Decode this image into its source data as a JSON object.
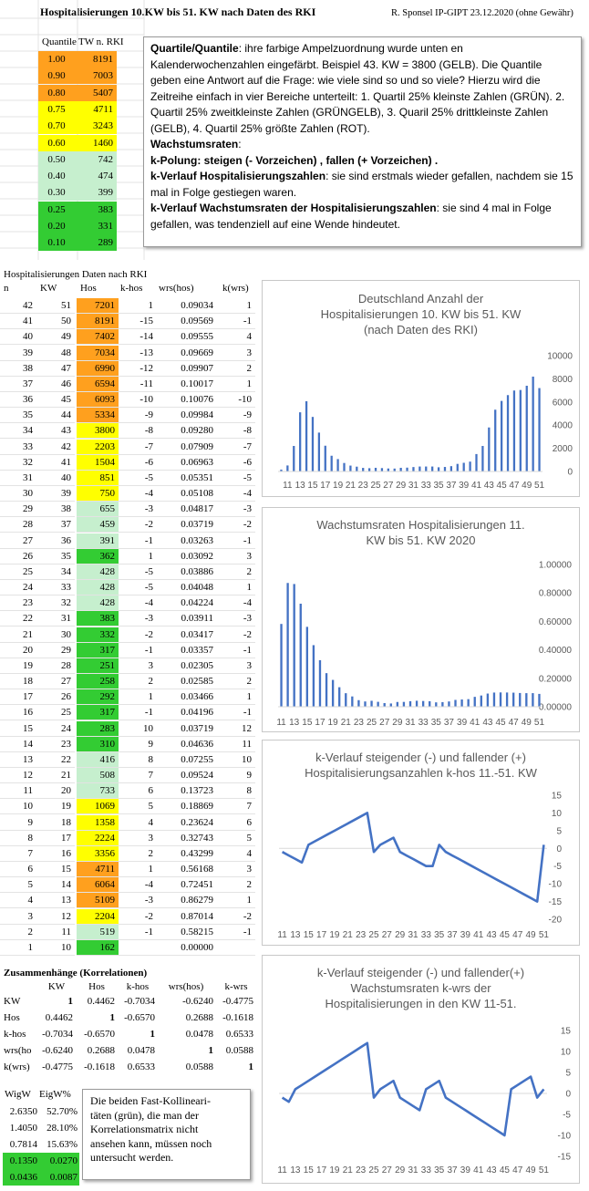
{
  "header": {
    "title": "Hospitalisierungen 10.KW bis 51. KW nach Daten des RKI",
    "right": "R. Sponsel IP-GIPT 23.12.2020 (ohne Gewähr)"
  },
  "colors": {
    "orange": "#ffa01e",
    "yellow": "#ffff00",
    "light_green": "#c6efce",
    "green": "#33cc33",
    "series": "#4472c4"
  },
  "quantile_table": {
    "headers": [
      "Quantile",
      "TW n. RKI"
    ],
    "rows": [
      {
        "q": "1.00",
        "tw": "8191",
        "color": "orange"
      },
      {
        "q": "0.90",
        "tw": "7003",
        "color": "orange"
      },
      {
        "q": "0.80",
        "tw": "5407",
        "color": "orange"
      },
      {
        "q": "0.75",
        "tw": "4711",
        "color": "yellow"
      },
      {
        "q": "0.70",
        "tw": "3243",
        "color": "yellow"
      },
      {
        "q": "0.60",
        "tw": "1460",
        "color": "yellow"
      },
      {
        "q": "0.50",
        "tw": "742",
        "color": "light_green"
      },
      {
        "q": "0.40",
        "tw": "474",
        "color": "light_green"
      },
      {
        "q": "0.30",
        "tw": "399",
        "color": "light_green"
      },
      {
        "q": "0.25",
        "tw": "383",
        "color": "green"
      },
      {
        "q": "0.20",
        "tw": "331",
        "color": "green"
      },
      {
        "q": "0.10",
        "tw": "289",
        "color": "green"
      }
    ]
  },
  "explanation": {
    "p1_bold": "Quartile/Quantile",
    "p1": ": ihre farbige Ampelzuordnung wurde unten en Kalenderwochenzahlen eingefärbt. Beispiel 43. KW = 3800 (GELB). Die Quantile geben eine Antwort auf die Frage: wie viele sind so und so viele? Hierzu wird die Zeitreihe einfach in vier Bereiche unterteilt: 1. Quartil 25% kleinste Zahlen (GRÜN). 2. Quartil 25% zweitkleinste Zahlen (GRÜNGELB), 3. Quaril 25% drittkleinste Zahlen (GELB), 4. Quartil 25% größte Zahlen (ROT).",
    "p2_bold": "Wachstumsraten",
    "p2": ":",
    "p3_bold": "k-Polung: steigen (- Vorzeichen) , fallen (+ Vorzeichen) .",
    "p4_bold": "k-Verlauf Hospitalisierungszahlen",
    "p4": ": sie sind erstmals wieder gefallen, nachdem sie 15 mal in Folge gestiegen waren.",
    "p5_bold": "k-Verlauf Wachstumsraten der Hospitalisierungszahlen",
    "p5": ": sie sind 4 mal in Folge gefallen, was tendenziell auf eine Wende hindeutet."
  },
  "data_table": {
    "title": "Hospitalisierungen Daten nach RKI",
    "headers": [
      "n",
      "KW",
      "Hos",
      "k-hos",
      "wrs(hos)",
      "k(wrs)"
    ],
    "rows": [
      {
        "n": "42",
        "kw": "51",
        "hos": "7201",
        "khos": "1",
        "wrs": "0.09034",
        "kwrs": "1",
        "color": "orange"
      },
      {
        "n": "41",
        "kw": "50",
        "hos": "8191",
        "khos": "-15",
        "wrs": "0.09569",
        "kwrs": "-1",
        "color": "orange"
      },
      {
        "n": "40",
        "kw": "49",
        "hos": "7402",
        "khos": "-14",
        "wrs": "0.09555",
        "kwrs": "4",
        "color": "orange"
      },
      {
        "n": "39",
        "kw": "48",
        "hos": "7034",
        "khos": "-13",
        "wrs": "0.09669",
        "kwrs": "3",
        "color": "orange"
      },
      {
        "n": "38",
        "kw": "47",
        "hos": "6990",
        "khos": "-12",
        "wrs": "0.09907",
        "kwrs": "2",
        "color": "orange"
      },
      {
        "n": "37",
        "kw": "46",
        "hos": "6594",
        "khos": "-11",
        "wrs": "0.10017",
        "kwrs": "1",
        "color": "orange"
      },
      {
        "n": "36",
        "kw": "45",
        "hos": "6093",
        "khos": "-10",
        "wrs": "0.10076",
        "kwrs": "-10",
        "color": "orange"
      },
      {
        "n": "35",
        "kw": "44",
        "hos": "5334",
        "khos": "-9",
        "wrs": "0.09984",
        "kwrs": "-9",
        "color": "orange"
      },
      {
        "n": "34",
        "kw": "43",
        "hos": "3800",
        "khos": "-8",
        "wrs": "0.09280",
        "kwrs": "-8",
        "color": "yellow"
      },
      {
        "n": "33",
        "kw": "42",
        "hos": "2203",
        "khos": "-7",
        "wrs": "0.07909",
        "kwrs": "-7",
        "color": "yellow"
      },
      {
        "n": "32",
        "kw": "41",
        "hos": "1504",
        "khos": "-6",
        "wrs": "0.06963",
        "kwrs": "-6",
        "color": "yellow"
      },
      {
        "n": "31",
        "kw": "40",
        "hos": "851",
        "khos": "-5",
        "wrs": "0.05351",
        "kwrs": "-5",
        "color": "yellow"
      },
      {
        "n": "30",
        "kw": "39",
        "hos": "750",
        "khos": "-4",
        "wrs": "0.05108",
        "kwrs": "-4",
        "color": "yellow"
      },
      {
        "n": "29",
        "kw": "38",
        "hos": "655",
        "khos": "-3",
        "wrs": "0.04817",
        "kwrs": "-3",
        "color": "light_green"
      },
      {
        "n": "28",
        "kw": "37",
        "hos": "459",
        "khos": "-2",
        "wrs": "0.03719",
        "kwrs": "-2",
        "color": "light_green"
      },
      {
        "n": "27",
        "kw": "36",
        "hos": "391",
        "khos": "-1",
        "wrs": "0.03263",
        "kwrs": "-1",
        "color": "light_green"
      },
      {
        "n": "26",
        "kw": "35",
        "hos": "362",
        "khos": "1",
        "wrs": "0.03092",
        "kwrs": "3",
        "color": "green"
      },
      {
        "n": "25",
        "kw": "34",
        "hos": "428",
        "khos": "-5",
        "wrs": "0.03886",
        "kwrs": "2",
        "color": "light_green"
      },
      {
        "n": "24",
        "kw": "33",
        "hos": "428",
        "khos": "-5",
        "wrs": "0.04048",
        "kwrs": "1",
        "color": "light_green"
      },
      {
        "n": "23",
        "kw": "32",
        "hos": "428",
        "khos": "-4",
        "wrs": "0.04224",
        "kwrs": "-4",
        "color": "light_green"
      },
      {
        "n": "22",
        "kw": "31",
        "hos": "383",
        "khos": "-3",
        "wrs": "0.03911",
        "kwrs": "-3",
        "color": "green"
      },
      {
        "n": "21",
        "kw": "30",
        "hos": "332",
        "khos": "-2",
        "wrs": "0.03417",
        "kwrs": "-2",
        "color": "green"
      },
      {
        "n": "20",
        "kw": "29",
        "hos": "317",
        "khos": "-1",
        "wrs": "0.03357",
        "kwrs": "-1",
        "color": "green"
      },
      {
        "n": "19",
        "kw": "28",
        "hos": "251",
        "khos": "3",
        "wrs": "0.02305",
        "kwrs": "3",
        "color": "green"
      },
      {
        "n": "18",
        "kw": "27",
        "hos": "258",
        "khos": "2",
        "wrs": "0.02585",
        "kwrs": "2",
        "color": "green"
      },
      {
        "n": "17",
        "kw": "26",
        "hos": "292",
        "khos": "1",
        "wrs": "0.03466",
        "kwrs": "1",
        "color": "green"
      },
      {
        "n": "16",
        "kw": "25",
        "hos": "317",
        "khos": "-1",
        "wrs": "0.04196",
        "kwrs": "-1",
        "color": "green"
      },
      {
        "n": "15",
        "kw": "24",
        "hos": "283",
        "khos": "10",
        "wrs": "0.03719",
        "kwrs": "12",
        "color": "green"
      },
      {
        "n": "14",
        "kw": "23",
        "hos": "310",
        "khos": "9",
        "wrs": "0.04636",
        "kwrs": "11",
        "color": "green"
      },
      {
        "n": "13",
        "kw": "22",
        "hos": "416",
        "khos": "8",
        "wrs": "0.07255",
        "kwrs": "10",
        "color": "light_green"
      },
      {
        "n": "12",
        "kw": "21",
        "hos": "508",
        "khos": "7",
        "wrs": "0.09524",
        "kwrs": "9",
        "color": "light_green"
      },
      {
        "n": "11",
        "kw": "20",
        "hos": "733",
        "khos": "6",
        "wrs": "0.13723",
        "kwrs": "8",
        "color": "light_green"
      },
      {
        "n": "10",
        "kw": "19",
        "hos": "1069",
        "khos": "5",
        "wrs": "0.18869",
        "kwrs": "7",
        "color": "yellow"
      },
      {
        "n": "9",
        "kw": "18",
        "hos": "1358",
        "khos": "4",
        "wrs": "0.23624",
        "kwrs": "6",
        "color": "yellow"
      },
      {
        "n": "8",
        "kw": "17",
        "hos": "2224",
        "khos": "3",
        "wrs": "0.32743",
        "kwrs": "5",
        "color": "yellow"
      },
      {
        "n": "7",
        "kw": "16",
        "hos": "3356",
        "khos": "2",
        "wrs": "0.43299",
        "kwrs": "4",
        "color": "yellow"
      },
      {
        "n": "6",
        "kw": "15",
        "hos": "4711",
        "khos": "1",
        "wrs": "0.56168",
        "kwrs": "3",
        "color": "orange"
      },
      {
        "n": "5",
        "kw": "14",
        "hos": "6064",
        "khos": "-4",
        "wrs": "0.72451",
        "kwrs": "2",
        "color": "orange"
      },
      {
        "n": "4",
        "kw": "13",
        "hos": "5109",
        "khos": "-3",
        "wrs": "0.86279",
        "kwrs": "1",
        "color": "orange"
      },
      {
        "n": "3",
        "kw": "12",
        "hos": "2204",
        "khos": "-2",
        "wrs": "0.87014",
        "kwrs": "-2",
        "color": "yellow"
      },
      {
        "n": "2",
        "kw": "11",
        "hos": "519",
        "khos": "-1",
        "wrs": "0.58215",
        "kwrs": "-1",
        "color": "light_green"
      },
      {
        "n": "1",
        "kw": "10",
        "hos": "162",
        "khos": "",
        "wrs": "0.00000",
        "kwrs": "",
        "color": "green"
      }
    ]
  },
  "correlations": {
    "title": "Zusammenhänge (Korrelationen)",
    "headers": [
      "KW",
      "Hos",
      "k-hos",
      "wrs(hos)",
      "k-wrs"
    ],
    "rows": [
      {
        "label": "KW",
        "vals": [
          "1",
          "0.4462",
          "-0.7034",
          "-0.6240",
          "-0.4775"
        ]
      },
      {
        "label": "Hos",
        "vals": [
          "0.4462",
          "1",
          "-0.6570",
          "0.2688",
          "-0.1618"
        ]
      },
      {
        "label": "k-hos",
        "vals": [
          "-0.7034",
          "-0.6570",
          "1",
          "0.0478",
          "0.6533"
        ]
      },
      {
        "label": "wrs(ho",
        "vals": [
          "-0.6240",
          "0.2688",
          "0.0478",
          "1",
          "0.0588"
        ]
      },
      {
        "label": "k(wrs)",
        "vals": [
          "-0.4775",
          "-0.1618",
          "0.6533",
          "0.0588",
          "1"
        ]
      }
    ]
  },
  "eigen": {
    "headers": [
      "WigW",
      "EigW%"
    ],
    "rows": [
      {
        "a": "2.6350",
        "b": "52.70%",
        "color": ""
      },
      {
        "a": "1.4050",
        "b": "28.10%",
        "color": ""
      },
      {
        "a": "0.7814",
        "b": "15.63%",
        "color": ""
      },
      {
        "a": "0.1350",
        "b": "0.0270",
        "color": "green"
      },
      {
        "a": "0.0436",
        "b": "0.0087",
        "color": "green"
      }
    ]
  },
  "note": "Die beiden Fast-Kollinearitäten (grün), die man der Korrelationsmatrix nicht ansehen kann, müssen noch untersucht werden.",
  "note_lines": [
    "Die beiden Fast-Kollineari-",
    "täten (grün), die man der",
    "Korrelationsmatrix nicht",
    "ansehen kann, müssen noch",
    "untersucht werden."
  ],
  "chart_data": [
    {
      "type": "bar",
      "title": "Deutschland Anzahl der Hospitalisierungen 10. KW bis 51. KW (nach Daten des RKI)",
      "title_lines": [
        "Deutschland Anzahl der",
        "Hospitalisierungen 10. KW bis 51. KW",
        "(nach Daten des RKI)"
      ],
      "x": [
        10,
        11,
        12,
        13,
        14,
        15,
        16,
        17,
        18,
        19,
        20,
        21,
        22,
        23,
        24,
        25,
        26,
        27,
        28,
        29,
        30,
        31,
        32,
        33,
        34,
        35,
        36,
        37,
        38,
        39,
        40,
        41,
        42,
        43,
        44,
        45,
        46,
        47,
        48,
        49,
        50,
        51
      ],
      "x_tick_labels": [
        "11",
        "13",
        "15",
        "17",
        "19",
        "21",
        "23",
        "25",
        "27",
        "29",
        "31",
        "33",
        "35",
        "37",
        "39",
        "41",
        "43",
        "45",
        "47",
        "49",
        "51"
      ],
      "values": [
        162,
        519,
        2204,
        5109,
        6064,
        4711,
        3356,
        2224,
        1358,
        1069,
        733,
        508,
        416,
        310,
        283,
        317,
        292,
        258,
        251,
        317,
        332,
        383,
        428,
        428,
        428,
        362,
        391,
        459,
        655,
        750,
        851,
        1504,
        2203,
        3800,
        5334,
        6093,
        6594,
        6990,
        7034,
        7402,
        8191,
        7201
      ],
      "ylim": [
        0,
        10000
      ],
      "y_ticks": [
        "0",
        "2000",
        "4000",
        "6000",
        "8000",
        "10000"
      ]
    },
    {
      "type": "bar",
      "title": "Wachstumsraten Hospitalisierungen 11. KW bis 51. KW 2020",
      "title_lines": [
        "Wachstumsraten Hospitalisierungen 11.",
        "KW bis 51. KW 2020"
      ],
      "x": [
        11,
        12,
        13,
        14,
        15,
        16,
        17,
        18,
        19,
        20,
        21,
        22,
        23,
        24,
        25,
        26,
        27,
        28,
        29,
        30,
        31,
        32,
        33,
        34,
        35,
        36,
        37,
        38,
        39,
        40,
        41,
        42,
        43,
        44,
        45,
        46,
        47,
        48,
        49,
        50,
        51
      ],
      "x_tick_labels": [
        "11",
        "13",
        "15",
        "17",
        "19",
        "21",
        "23",
        "25",
        "27",
        "29",
        "31",
        "33",
        "35",
        "37",
        "39",
        "41",
        "43",
        "45",
        "47",
        "49",
        "51"
      ],
      "values": [
        0.58215,
        0.87014,
        0.86279,
        0.72451,
        0.56168,
        0.43299,
        0.32743,
        0.23624,
        0.18869,
        0.13723,
        0.09524,
        0.07255,
        0.04636,
        0.03719,
        0.04196,
        0.03466,
        0.02585,
        0.02305,
        0.03357,
        0.03417,
        0.03911,
        0.04224,
        0.04048,
        0.03886,
        0.03092,
        0.03263,
        0.03719,
        0.04817,
        0.05108,
        0.05351,
        0.06963,
        0.07909,
        0.0928,
        0.09984,
        0.10076,
        0.10017,
        0.09907,
        0.09669,
        0.09555,
        0.09569,
        0.09034
      ],
      "ylim": [
        0,
        1
      ],
      "y_ticks": [
        "0.00000",
        "0.20000",
        "0.40000",
        "0.60000",
        "0.80000",
        "1.00000"
      ]
    },
    {
      "type": "line",
      "title": "k-Verlauf steigender (-) und fallender (+) Hospitalisierungsanzahlen k-hos 11.-51. KW",
      "title_lines": [
        "k-Verlauf steigender (-) und fallender (+)",
        "Hospitalisierungsanzahlen k-hos 11.-51. KW"
      ],
      "x": [
        11,
        12,
        13,
        14,
        15,
        16,
        17,
        18,
        19,
        20,
        21,
        22,
        23,
        24,
        25,
        26,
        27,
        28,
        29,
        30,
        31,
        32,
        33,
        34,
        35,
        36,
        37,
        38,
        39,
        40,
        41,
        42,
        43,
        44,
        45,
        46,
        47,
        48,
        49,
        50,
        51
      ],
      "x_tick_labels": [
        "11",
        "13",
        "15",
        "17",
        "19",
        "21",
        "23",
        "25",
        "27",
        "29",
        "31",
        "33",
        "35",
        "37",
        "39",
        "41",
        "43",
        "45",
        "47",
        "49",
        "51"
      ],
      "values": [
        -1,
        -2,
        -3,
        -4,
        1,
        2,
        3,
        4,
        5,
        6,
        7,
        8,
        9,
        10,
        -1,
        1,
        2,
        3,
        -1,
        -2,
        -3,
        -4,
        -5,
        -5,
        1,
        -1,
        -2,
        -3,
        -4,
        -5,
        -6,
        -7,
        -8,
        -9,
        -10,
        -11,
        -12,
        -13,
        -14,
        -15,
        1
      ],
      "ylim": [
        -20,
        15
      ],
      "y_ticks": [
        "-20",
        "-15",
        "-10",
        "-5",
        "0",
        "5",
        "10",
        "15"
      ],
      "color": "#4472c4"
    },
    {
      "type": "line",
      "title": "k-Verlauf steigender (-) und fallender(+) Wachstumsraten k-wrs der Hospitalisierungen in den KW 11-51.",
      "title_lines": [
        "k-Verlauf steigender (-) und fallender(+)",
        "Wachstumsraten k-wrs der",
        "Hospitalisierungen in den KW 11-51."
      ],
      "x": [
        11,
        12,
        13,
        14,
        15,
        16,
        17,
        18,
        19,
        20,
        21,
        22,
        23,
        24,
        25,
        26,
        27,
        28,
        29,
        30,
        31,
        32,
        33,
        34,
        35,
        36,
        37,
        38,
        39,
        40,
        41,
        42,
        43,
        44,
        45,
        46,
        47,
        48,
        49,
        50,
        51
      ],
      "x_tick_labels": [
        "11",
        "13",
        "15",
        "17",
        "19",
        "21",
        "23",
        "25",
        "27",
        "29",
        "31",
        "33",
        "35",
        "37",
        "39",
        "41",
        "43",
        "45",
        "47",
        "49",
        "51"
      ],
      "values": [
        -1,
        -2,
        1,
        2,
        3,
        4,
        5,
        6,
        7,
        8,
        9,
        10,
        11,
        12,
        -1,
        1,
        2,
        3,
        -1,
        -2,
        -3,
        -4,
        1,
        2,
        3,
        -1,
        -2,
        -3,
        -4,
        -5,
        -6,
        -7,
        -8,
        -9,
        -10,
        1,
        2,
        3,
        4,
        -1,
        1
      ],
      "ylim": [
        -15,
        15
      ],
      "y_ticks": [
        "-15",
        "-10",
        "-5",
        "0",
        "5",
        "10",
        "15"
      ],
      "color": "#4472c4"
    }
  ]
}
